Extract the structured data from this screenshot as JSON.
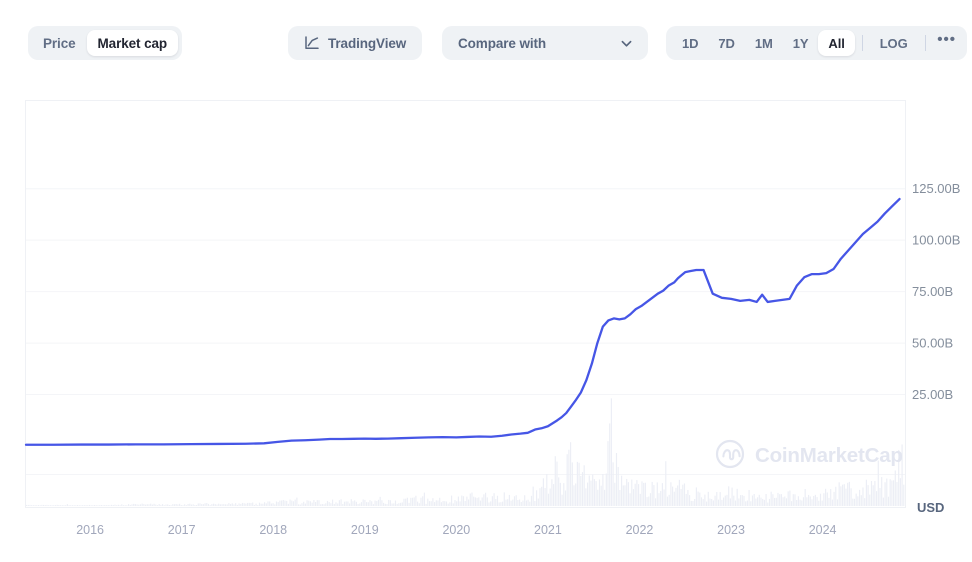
{
  "toolbar": {
    "metric_toggle": {
      "name": "price-marketcap-toggle",
      "options": [
        {
          "label": "Price",
          "active": false
        },
        {
          "label": "Market cap",
          "active": true
        }
      ]
    },
    "tradingview": {
      "label": "TradingView",
      "icon": "line-chart-icon"
    },
    "compare": {
      "label": "Compare with",
      "placeholder": "Compare with",
      "icon": "chevron-down-icon"
    },
    "ranges": [
      {
        "label": "1D",
        "active": false
      },
      {
        "label": "7D",
        "active": false
      },
      {
        "label": "1M",
        "active": false
      },
      {
        "label": "1Y",
        "active": false
      },
      {
        "label": "All",
        "active": true
      }
    ],
    "log_label": "LOG",
    "more_label": "•••"
  },
  "chart": {
    "watermark": "CoinMarketCap",
    "watermark_icon": "coinmarketcap-logo-icon",
    "currency": "USD",
    "line_color": "#4656e6",
    "volume_color": "#eceef5",
    "grid_color": "#f4f5f8",
    "border_color": "#eff1f5"
  },
  "chart_data": {
    "type": "line",
    "title": "",
    "xlabel": "",
    "ylabel": "",
    "ylim": [
      0,
      137.5
    ],
    "xlim": [
      2015.3,
      2024.9
    ],
    "grid": true,
    "legend": false,
    "y_ticks": [
      25,
      50,
      75,
      100,
      125
    ],
    "y_tick_labels": [
      "25.00B",
      "50.00B",
      "75.00B",
      "100.00B",
      "125.00B"
    ],
    "x_ticks": [
      2016,
      2017,
      2018,
      2019,
      2020,
      2021,
      2022,
      2023,
      2024
    ],
    "x_tick_labels": [
      "2016",
      "2017",
      "2018",
      "2019",
      "2020",
      "2021",
      "2022",
      "2023",
      "2024"
    ],
    "series": [
      {
        "name": "Market cap",
        "unit": "USD",
        "color": "#4656e6",
        "x": [
          2015.3,
          2015.6,
          2015.9,
          2016.2,
          2016.5,
          2016.8,
          2017.1,
          2017.4,
          2017.7,
          2017.9,
          2018.05,
          2018.2,
          2018.35,
          2018.5,
          2018.62,
          2018.75,
          2018.88,
          2019.0,
          2019.12,
          2019.25,
          2019.4,
          2019.55,
          2019.7,
          2019.85,
          2020.0,
          2020.12,
          2020.25,
          2020.38,
          2020.5,
          2020.6,
          2020.7,
          2020.78,
          2020.86,
          2020.93,
          2021.0,
          2021.05,
          2021.1,
          2021.15,
          2021.2,
          2021.25,
          2021.3,
          2021.36,
          2021.42,
          2021.48,
          2021.54,
          2021.6,
          2021.66,
          2021.72,
          2021.78,
          2021.84,
          2021.9,
          2021.96,
          2022.02,
          2022.08,
          2022.14,
          2022.2,
          2022.26,
          2022.32,
          2022.38,
          2022.42,
          2022.46,
          2022.5,
          2022.56,
          2022.62,
          2022.7,
          2022.8,
          2022.9,
          2023.0,
          2023.1,
          2023.2,
          2023.28,
          2023.34,
          2023.4,
          2023.48,
          2023.56,
          2023.64,
          2023.72,
          2023.8,
          2023.88,
          2023.96,
          2024.04,
          2024.12,
          2024.2,
          2024.28,
          2024.36,
          2024.44,
          2024.52,
          2024.6,
          2024.68,
          2024.76,
          2024.84
        ],
        "y": [
          0.6,
          0.6,
          0.7,
          0.7,
          0.8,
          0.8,
          0.9,
          1.0,
          1.1,
          1.3,
          2.0,
          2.6,
          2.8,
          3.1,
          3.4,
          3.4,
          3.5,
          3.6,
          3.5,
          3.6,
          3.8,
          4.0,
          4.2,
          4.3,
          4.2,
          4.4,
          4.6,
          4.5,
          5.0,
          5.6,
          6.0,
          6.4,
          8.0,
          8.6,
          9.6,
          11.0,
          12.4,
          14.0,
          16.0,
          19.0,
          22.0,
          26.0,
          32.0,
          40.0,
          50.0,
          58.0,
          61.0,
          62.0,
          61.5,
          62.0,
          64.0,
          66.5,
          68.0,
          70.0,
          72.0,
          74.0,
          75.5,
          78.0,
          79.5,
          81.5,
          83.0,
          84.5,
          85.0,
          85.5,
          85.5,
          74.0,
          72.0,
          71.5,
          70.5,
          71.0,
          70.0,
          73.5,
          70.0,
          70.5,
          71.0,
          71.5,
          78.0,
          82.0,
          83.5,
          83.5,
          84.0,
          86.0,
          91.0,
          95.0,
          99.0,
          103.0,
          106.0,
          109.0,
          113.0,
          116.5,
          120.0
        ]
      }
    ],
    "volume": {
      "name": "Volume",
      "color": "#eceef5",
      "x": [
        2015.3,
        2015.6,
        2015.9,
        2016.2,
        2016.5,
        2016.8,
        2017.1,
        2017.4,
        2017.7,
        2017.9,
        2018.05,
        2018.2,
        2018.35,
        2018.5,
        2018.62,
        2018.75,
        2018.88,
        2019.0,
        2019.12,
        2019.25,
        2019.4,
        2019.55,
        2019.7,
        2019.85,
        2020.0,
        2020.12,
        2020.25,
        2020.38,
        2020.5,
        2020.6,
        2020.7,
        2020.78,
        2020.86,
        2020.93,
        2021.0,
        2021.05,
        2021.1,
        2021.15,
        2021.2,
        2021.25,
        2021.3,
        2021.36,
        2021.42,
        2021.48,
        2021.54,
        2021.6,
        2021.66,
        2021.72,
        2021.78,
        2021.84,
        2021.9,
        2021.96,
        2022.02,
        2022.08,
        2022.14,
        2022.2,
        2022.26,
        2022.32,
        2022.38,
        2022.42,
        2022.46,
        2022.5,
        2022.56,
        2022.62,
        2022.7,
        2022.8,
        2022.9,
        2023.0,
        2023.1,
        2023.2,
        2023.28,
        2023.34,
        2023.4,
        2023.48,
        2023.56,
        2023.64,
        2023.72,
        2023.8,
        2023.88,
        2023.96,
        2024.04,
        2024.12,
        2024.2,
        2024.28,
        2024.36,
        2024.44,
        2024.52,
        2024.6,
        2024.68,
        2024.76,
        2024.84
      ],
      "y": [
        1,
        1,
        1,
        1,
        2,
        2,
        2,
        3,
        3,
        4,
        5,
        6,
        5,
        6,
        7,
        6,
        6,
        7,
        6,
        7,
        8,
        9,
        8,
        9,
        9,
        12,
        14,
        11,
        13,
        15,
        14,
        16,
        20,
        24,
        30,
        44,
        52,
        38,
        46,
        60,
        40,
        55,
        34,
        30,
        28,
        42,
        76,
        52,
        36,
        30,
        26,
        24,
        22,
        28,
        24,
        22,
        20,
        24,
        18,
        22,
        26,
        20,
        18,
        16,
        15,
        14,
        16,
        18,
        14,
        16,
        13,
        15,
        12,
        13,
        12,
        14,
        13,
        15,
        16,
        14,
        18,
        22,
        20,
        24,
        22,
        20,
        28,
        24,
        26,
        30,
        58
      ]
    }
  }
}
